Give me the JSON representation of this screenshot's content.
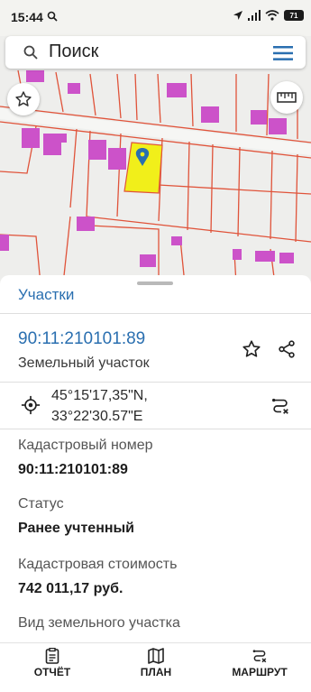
{
  "status_bar": {
    "time": "15:44",
    "battery": "71"
  },
  "search": {
    "placeholder": "Поиск"
  },
  "sheet": {
    "title": "Участки",
    "cadastral_number_link": "90:11:210101:89",
    "parcel_type": "Земельный участок",
    "coords_lat": "45°15'17,35\"N,",
    "coords_lon": "33°22'30.57\"E",
    "fields": [
      {
        "label": "Кадастровый номер",
        "value": "90:11:210101:89"
      },
      {
        "label": "Статус",
        "value": "Ранее учтенный"
      },
      {
        "label": "Кадастровая стоимость",
        "value": "742 011,17 руб."
      },
      {
        "label": "Вид земельного участка",
        "value": ""
      }
    ]
  },
  "bottom_nav": {
    "report": "ОТЧЁТ",
    "plan": "ПЛАН",
    "route": "МАРШРУТ"
  },
  "colors": {
    "accent": "#2a6fb0",
    "parcel_line": "#e0533a",
    "building": "#cc52c9",
    "selected_parcel": "#f1ef1a"
  },
  "icons": {
    "search": "search-icon",
    "menu": "menu-icon",
    "favorite_map": "star-icon",
    "ruler": "ruler-icon",
    "pin": "map-pin-icon",
    "star": "star-icon",
    "share": "share-icon",
    "gps": "crosshair-icon",
    "route": "route-icon",
    "report": "document-icon",
    "plan": "map-icon"
  }
}
